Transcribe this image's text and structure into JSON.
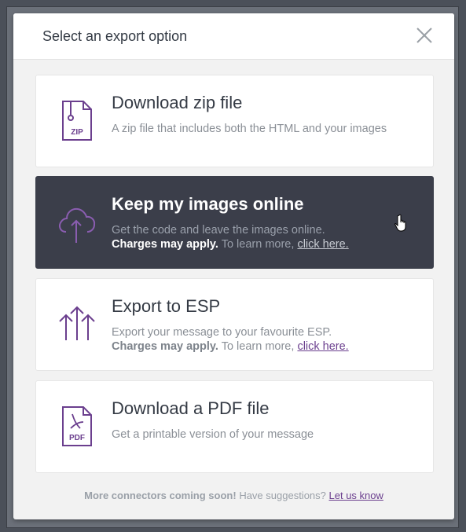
{
  "modal": {
    "title": "Select an export option",
    "close_label": "×"
  },
  "options": [
    {
      "title": "Download zip file",
      "desc": "A zip file that includes both the HTML and your images",
      "icon": "zip-file-icon",
      "icon_text": "ZIP"
    },
    {
      "title": "Keep my images online",
      "desc": "Get the code and leave the images online.",
      "charges": "Charges may apply.",
      "learn": "To learn more,",
      "link": "click here.",
      "icon": "cloud-upload-icon"
    },
    {
      "title": "Export to ESP",
      "desc": "Export your message to your favourite ESP.",
      "charges": "Charges may apply.",
      "learn": "To learn more,",
      "link": "click here.",
      "icon": "export-arrows-icon"
    },
    {
      "title": "Download a PDF file",
      "desc": "Get a printable version of your message",
      "icon": "pdf-file-icon",
      "icon_text": "PDF"
    }
  ],
  "footer": {
    "coming_soon": "More connectors coming soon!",
    "suggestions": "Have suggestions?",
    "link": "Let us know"
  },
  "colors": {
    "accent": "#6b3f8e",
    "active_card": "#3b3e4a",
    "modal_bg": "#f2f2f2"
  }
}
